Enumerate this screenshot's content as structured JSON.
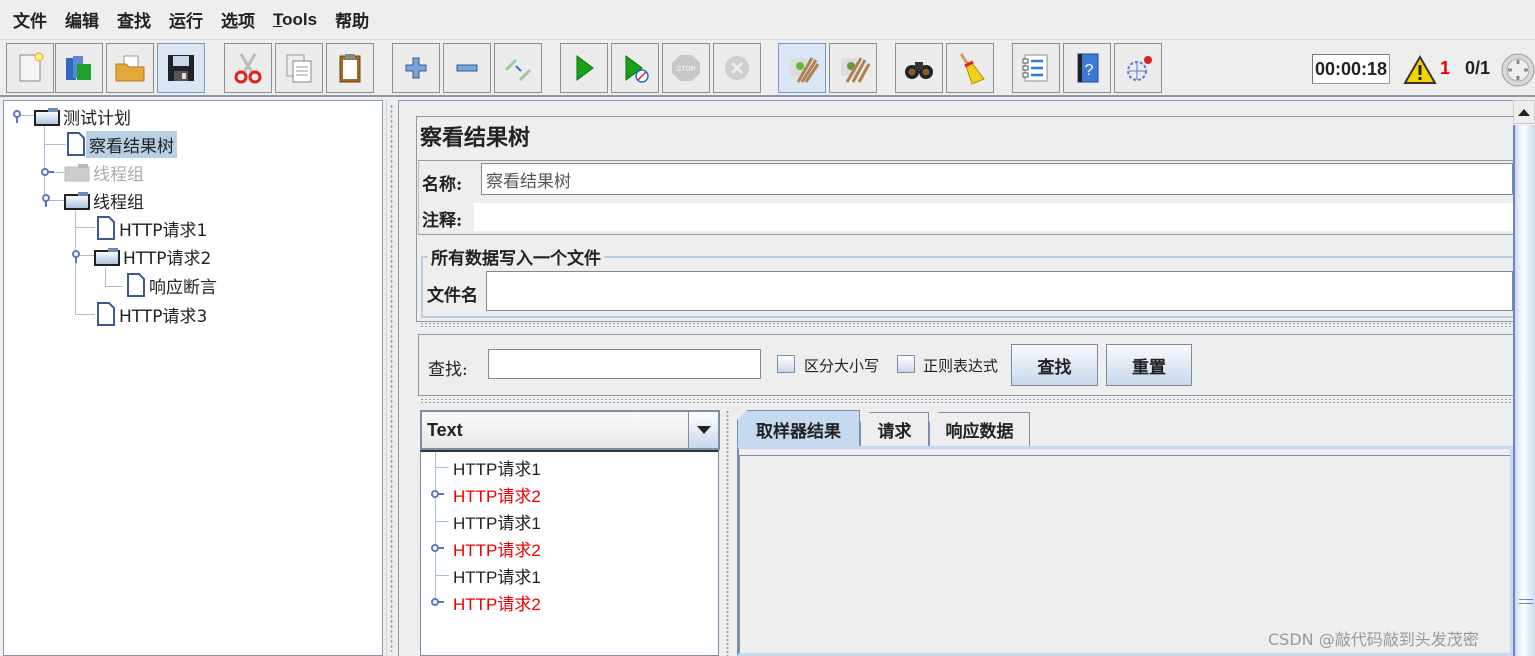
{
  "menu": {
    "items": [
      "文件",
      "编辑",
      "查找",
      "运行",
      "选项",
      "Tools",
      "帮助"
    ]
  },
  "toolbar": {
    "buttons": [
      {
        "name": "new-icon",
        "tooltip": "New"
      },
      {
        "name": "templates-icon",
        "tooltip": "Templates"
      },
      {
        "name": "open-icon",
        "tooltip": "Open"
      },
      {
        "name": "save-icon",
        "tooltip": "Save"
      },
      {
        "name": "cut-icon",
        "tooltip": "Cut"
      },
      {
        "name": "copy-icon",
        "tooltip": "Copy"
      },
      {
        "name": "paste-icon",
        "tooltip": "Paste"
      },
      {
        "name": "expand-icon",
        "tooltip": "Expand All"
      },
      {
        "name": "collapse-icon",
        "tooltip": "Collapse All"
      },
      {
        "name": "toggle-icon",
        "tooltip": "Toggle"
      },
      {
        "name": "start-icon",
        "tooltip": "Start"
      },
      {
        "name": "start-no-pause-icon",
        "tooltip": "Start no pauses"
      },
      {
        "name": "stop-icon",
        "tooltip": "Stop"
      },
      {
        "name": "shutdown-icon",
        "tooltip": "Shutdown"
      },
      {
        "name": "clear-icon",
        "tooltip": "Clear"
      },
      {
        "name": "clear-all-icon",
        "tooltip": "Clear All"
      },
      {
        "name": "search-icon",
        "tooltip": "Search"
      },
      {
        "name": "reset-search-icon",
        "tooltip": "Reset Search"
      },
      {
        "name": "function-helper-icon",
        "tooltip": "Function Helper"
      },
      {
        "name": "help-icon",
        "tooltip": "Help"
      },
      {
        "name": "remote-icon",
        "tooltip": "Remote"
      }
    ],
    "timer": "00:00:18",
    "warning_count": "1",
    "threads": "0/1"
  },
  "tree": {
    "nodes": [
      {
        "label": "测试计划",
        "type": "folder",
        "level": 0,
        "expanded": true
      },
      {
        "label": "察看结果树",
        "type": "doc",
        "level": 1,
        "selected": true
      },
      {
        "label": "线程组",
        "type": "folder",
        "level": 1,
        "disabled": true,
        "expanded": false
      },
      {
        "label": "线程组",
        "type": "folder",
        "level": 1,
        "expanded": true
      },
      {
        "label": "HTTP请求1",
        "type": "doc",
        "level": 2
      },
      {
        "label": "HTTP请求2",
        "type": "folder",
        "level": 2,
        "expanded": true
      },
      {
        "label": "响应断言",
        "type": "doc",
        "level": 3
      },
      {
        "label": "HTTP请求3",
        "type": "doc",
        "level": 2
      }
    ]
  },
  "panel": {
    "title": "察看结果树",
    "name_label": "名称:",
    "name_value": "察看结果树",
    "comment_label": "注释:",
    "comment_value": "",
    "file_group_legend": "所有数据写入一个文件",
    "filename_label": "文件名",
    "filename_value": ""
  },
  "search": {
    "label": "查找:",
    "value": "",
    "case_sensitive_label": "区分大小写",
    "case_sensitive_checked": false,
    "regex_label": "正则表达式",
    "regex_checked": false,
    "find_button": "查找",
    "reset_button": "重置"
  },
  "results": {
    "renderer": "Text",
    "items": [
      {
        "label": "HTTP请求1",
        "error": false,
        "expandable": false
      },
      {
        "label": "HTTP请求2",
        "error": true,
        "expandable": true
      },
      {
        "label": "HTTP请求1",
        "error": false,
        "expandable": false
      },
      {
        "label": "HTTP请求2",
        "error": true,
        "expandable": true
      },
      {
        "label": "HTTP请求1",
        "error": false,
        "expandable": false
      },
      {
        "label": "HTTP请求2",
        "error": true,
        "expandable": true
      }
    ],
    "tabs": [
      "取样器结果",
      "请求",
      "响应数据"
    ],
    "active_tab": 0
  },
  "colors": {
    "error": "#ee0000",
    "selection": "#b8cfe5",
    "accent": "#c5daf1"
  },
  "watermark": "CSDN @敲代码敲到头发茂密"
}
